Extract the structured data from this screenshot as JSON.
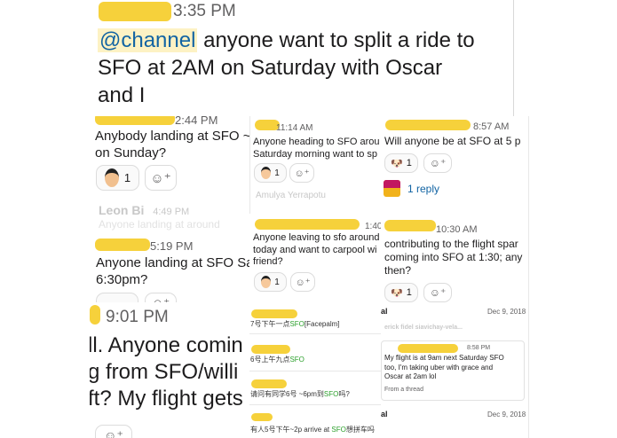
{
  "top": {
    "time": "3:35 PM",
    "mention": "@channel",
    "text_line1": " anyone want to split a ride to",
    "text_line2": "SFO at 2AM on Saturday with Oscar",
    "text_line3": "and I"
  },
  "p1": {
    "time": "2:44 PM",
    "text_line1": "Anybody landing at SFO ~",
    "text_line2": "on Sunday?",
    "reaction_count": "1"
  },
  "p2": {
    "time": "11:14 AM",
    "text_line1": "Anyone heading to SFO arou",
    "text_line2": "Saturday morning want to sp",
    "reaction_count": "1",
    "faded_name": "Amulya Yerrapotu"
  },
  "p3": {
    "time": "8:57 AM",
    "text": "Will anyone be at SFO at 5 p",
    "reaction_count": "1",
    "reply": "1 reply"
  },
  "p4": {
    "faded_name": "Leon Bi",
    "faded_time": "4:49 PM",
    "time": "5:19 PM",
    "text_line1": "Anyone landing at SFO Sa",
    "text_line2": "6:30pm?"
  },
  "p5": {
    "time": "1:40",
    "text_line1": "Anyone leaving to sfo around",
    "text_line2": "today and want to carpool wi",
    "text_line3": "friend?",
    "reaction_count": "1"
  },
  "p6": {
    "time": "10:30 AM",
    "text_line1": "contributing to the flight spar",
    "text_line2": "coming into SFO at 1:30; any",
    "text_line3": "then?",
    "reaction_count": "1"
  },
  "p7": {
    "time": "9:01 PM",
    "text_line1": "ll. Anyone comin",
    "text_line2": "g from SFO/willi",
    "text_line3": "ft? My flight gets"
  },
  "p8": {
    "row1": "7号下午一点SFO[Facepalm]",
    "row2": "6号上午九点SFO",
    "row3": "请问有同学6号 ~6pm到SFO吗?",
    "row4": "有人5号下午~2p arrive at SFO想拼车吗"
  },
  "p9": {
    "head_letter": "al",
    "date1": "Dec 9, 2018",
    "faded_name": "erick fidel siavichay-vela...",
    "time": "8:58 PM",
    "text_line1": "My flight is at 9am next Saturday SFO",
    "text_line2": "too, I'm taking uber with grace and",
    "text_line3": "Oscar at 2am lol",
    "from": "From a thread",
    "date2": "Dec 9, 2018"
  },
  "colors": {
    "mention_bg": "#fdf2c4",
    "link": "#1264a3",
    "redaction": "#f5cd2a",
    "sfo_green": "#2ca02c"
  }
}
